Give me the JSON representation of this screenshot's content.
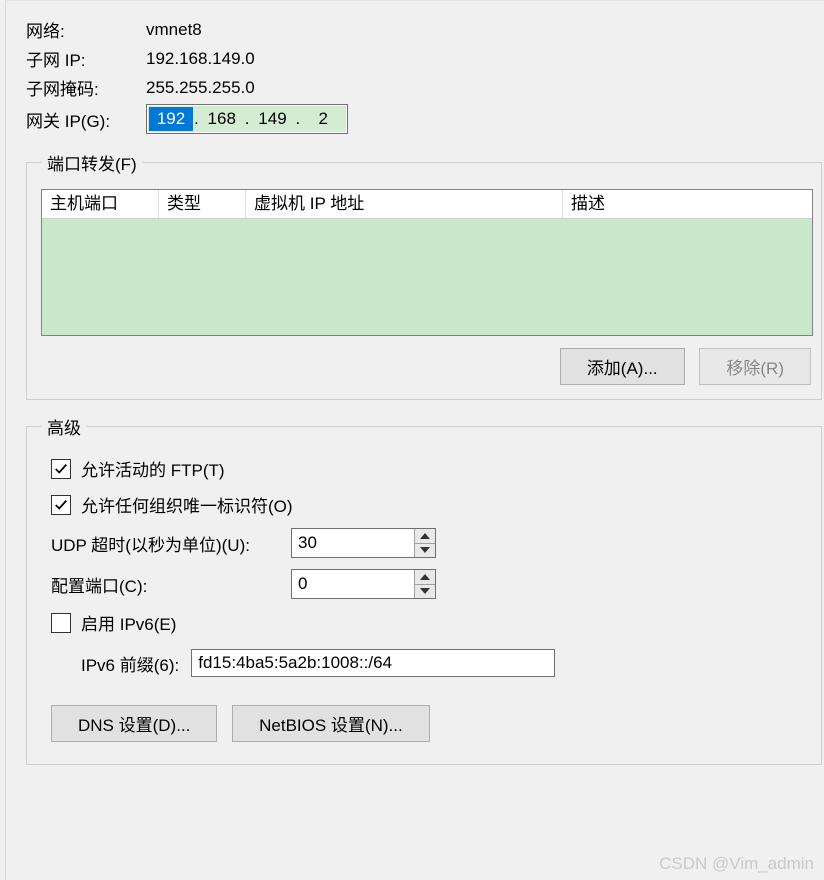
{
  "info": {
    "network_label": "网络:",
    "network_value": "vmnet8",
    "subnet_ip_label": "子网 IP:",
    "subnet_ip_value": "192.168.149.0",
    "subnet_mask_label": "子网掩码:",
    "subnet_mask_value": "255.255.255.0",
    "gateway_label": "网关 IP(G):",
    "gateway_octets": [
      "192",
      "168",
      "149",
      "2"
    ]
  },
  "port_forward": {
    "legend": "端口转发(F)",
    "columns": {
      "host_port": "主机端口",
      "type": "类型",
      "vm_ip": "虚拟机 IP 地址",
      "desc": "描述"
    },
    "buttons": {
      "add": "添加(A)...",
      "remove": "移除(R)"
    }
  },
  "advanced": {
    "legend": "高级",
    "allow_active_ftp": {
      "label": "允许活动的 FTP(T)",
      "checked": true
    },
    "allow_any_oui": {
      "label": "允许任何组织唯一标识符(O)",
      "checked": true
    },
    "udp_timeout": {
      "label": "UDP 超时(以秒为单位)(U):",
      "value": "30"
    },
    "config_port": {
      "label": "配置端口(C):",
      "value": "0"
    },
    "enable_ipv6": {
      "label": "启用 IPv6(E)",
      "checked": false
    },
    "ipv6_prefix": {
      "label": "IPv6 前缀(6):",
      "value": "fd15:4ba5:5a2b:1008::/64"
    },
    "buttons": {
      "dns": "DNS 设置(D)...",
      "netbios": "NetBIOS 设置(N)..."
    }
  },
  "watermark": "CSDN @Vim_admin"
}
